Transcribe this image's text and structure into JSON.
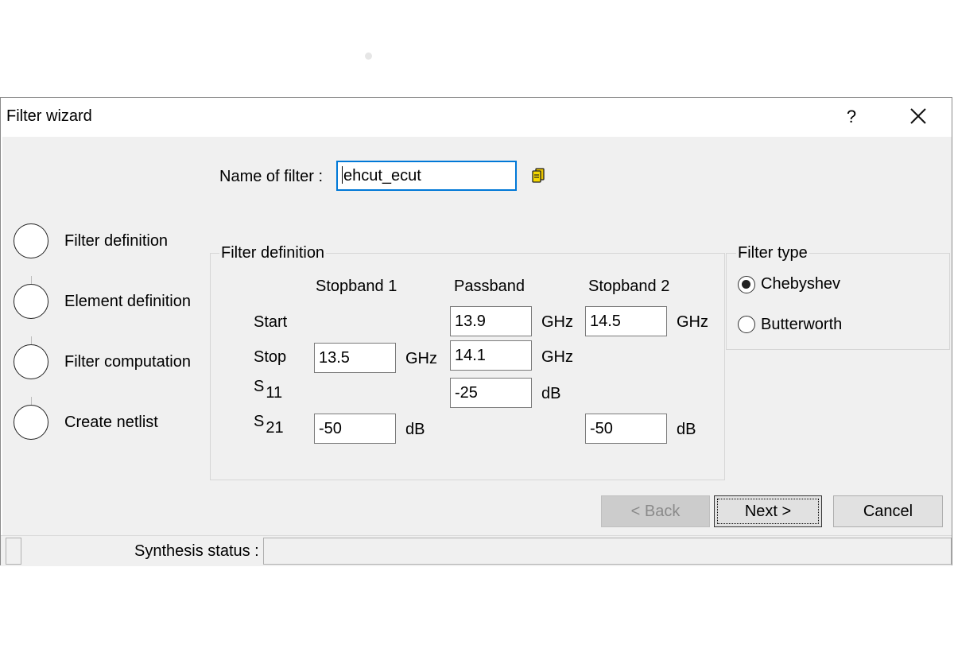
{
  "window": {
    "title": "Filter wizard",
    "help_label": "?"
  },
  "steps": [
    "Filter definition",
    "Element definition",
    "Filter computation",
    "Create netlist"
  ],
  "name_field": {
    "label": "Name of filter :",
    "value": "ehcut_ecut"
  },
  "filter_definition": {
    "title": "Filter definition",
    "columns": [
      "Stopband 1",
      "Passband",
      "Stopband 2"
    ],
    "rows": {
      "start": {
        "label": "Start",
        "passband": "13.9",
        "passband_unit": "GHz",
        "stopband2": "14.5",
        "stopband2_unit": "GHz"
      },
      "stop": {
        "label": "Stop",
        "stopband1": "13.5",
        "stopband1_unit": "GHz",
        "passband": "14.1",
        "passband_unit": "GHz"
      },
      "s11": {
        "label": "S",
        "sub": "11",
        "passband": "-25",
        "passband_unit": "dB"
      },
      "s21": {
        "label": "S",
        "sub": "21",
        "stopband1": "-50",
        "stopband1_unit": "dB",
        "stopband2": "-50",
        "stopband2_unit": "dB"
      }
    }
  },
  "filter_type": {
    "title": "Filter type",
    "options": [
      {
        "label": "Chebyshev",
        "selected": true
      },
      {
        "label": "Butterworth",
        "selected": false
      }
    ]
  },
  "buttons": {
    "back": "< Back",
    "next": "Next >",
    "cancel": "Cancel"
  },
  "status": {
    "label": "Synthesis status :",
    "value": ""
  },
  "colors": {
    "focus_border": "#0078d7",
    "panel_bg": "#f0f0f0",
    "disabled_button_bg": "#cccccc"
  },
  "icons": {
    "name_action": "database-icon",
    "close": "close-icon"
  }
}
